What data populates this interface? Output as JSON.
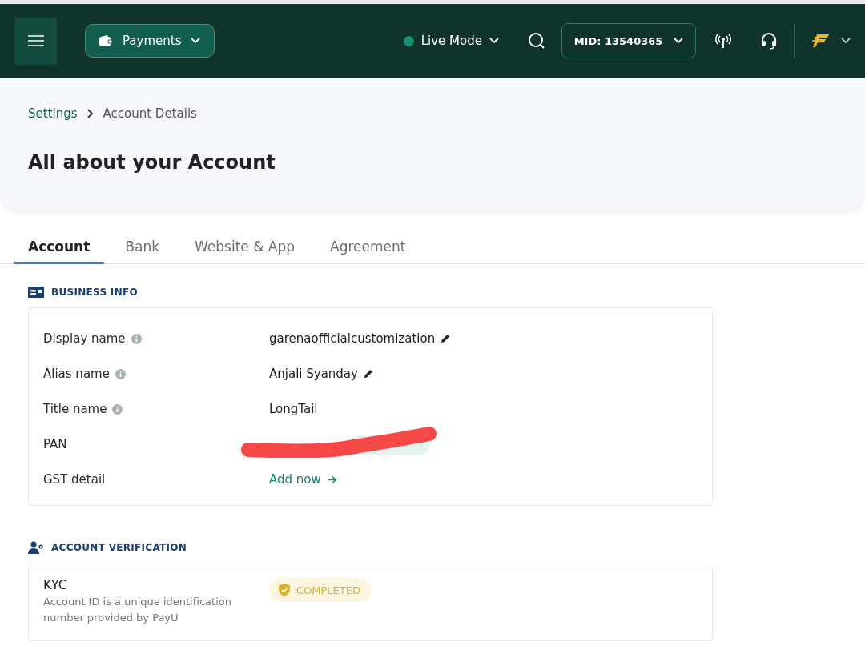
{
  "header": {
    "product": "Payments",
    "mode": {
      "label": "Live Mode",
      "on": true
    },
    "mid": "MID: 13540365"
  },
  "breadcrumb": [
    {
      "label": "Settings",
      "link": true
    },
    {
      "label": "Account Details",
      "link": false
    }
  ],
  "page_title": "All about your Account",
  "tabs": [
    {
      "label": "Account",
      "selected": true
    },
    {
      "label": "Bank",
      "selected": false
    },
    {
      "label": "Website & App",
      "selected": false
    },
    {
      "label": "Agreement",
      "selected": false
    }
  ],
  "business_info": {
    "title": "BUSINESS INFO",
    "rows": [
      {
        "kind": "text",
        "label": "Display name",
        "info": true,
        "value": "garenaofficialcustomization",
        "editable": true
      },
      {
        "kind": "text",
        "label": "Alias name",
        "info": true,
        "value": "Anjali Syanday",
        "editable": true
      },
      {
        "kind": "text",
        "label": "Title name",
        "info": true,
        "value": "LongTail",
        "editable": false
      },
      {
        "kind": "redacted",
        "label": "PAN",
        "info": false
      },
      {
        "kind": "link",
        "label": "GST detail",
        "info": false,
        "value": "Add now"
      }
    ]
  },
  "account_verification": {
    "title": "ACCOUNT VERIFICATION",
    "label": "KYC",
    "description": "Account ID is a unique identification number provided by PayU",
    "status": "COMPLETED"
  }
}
